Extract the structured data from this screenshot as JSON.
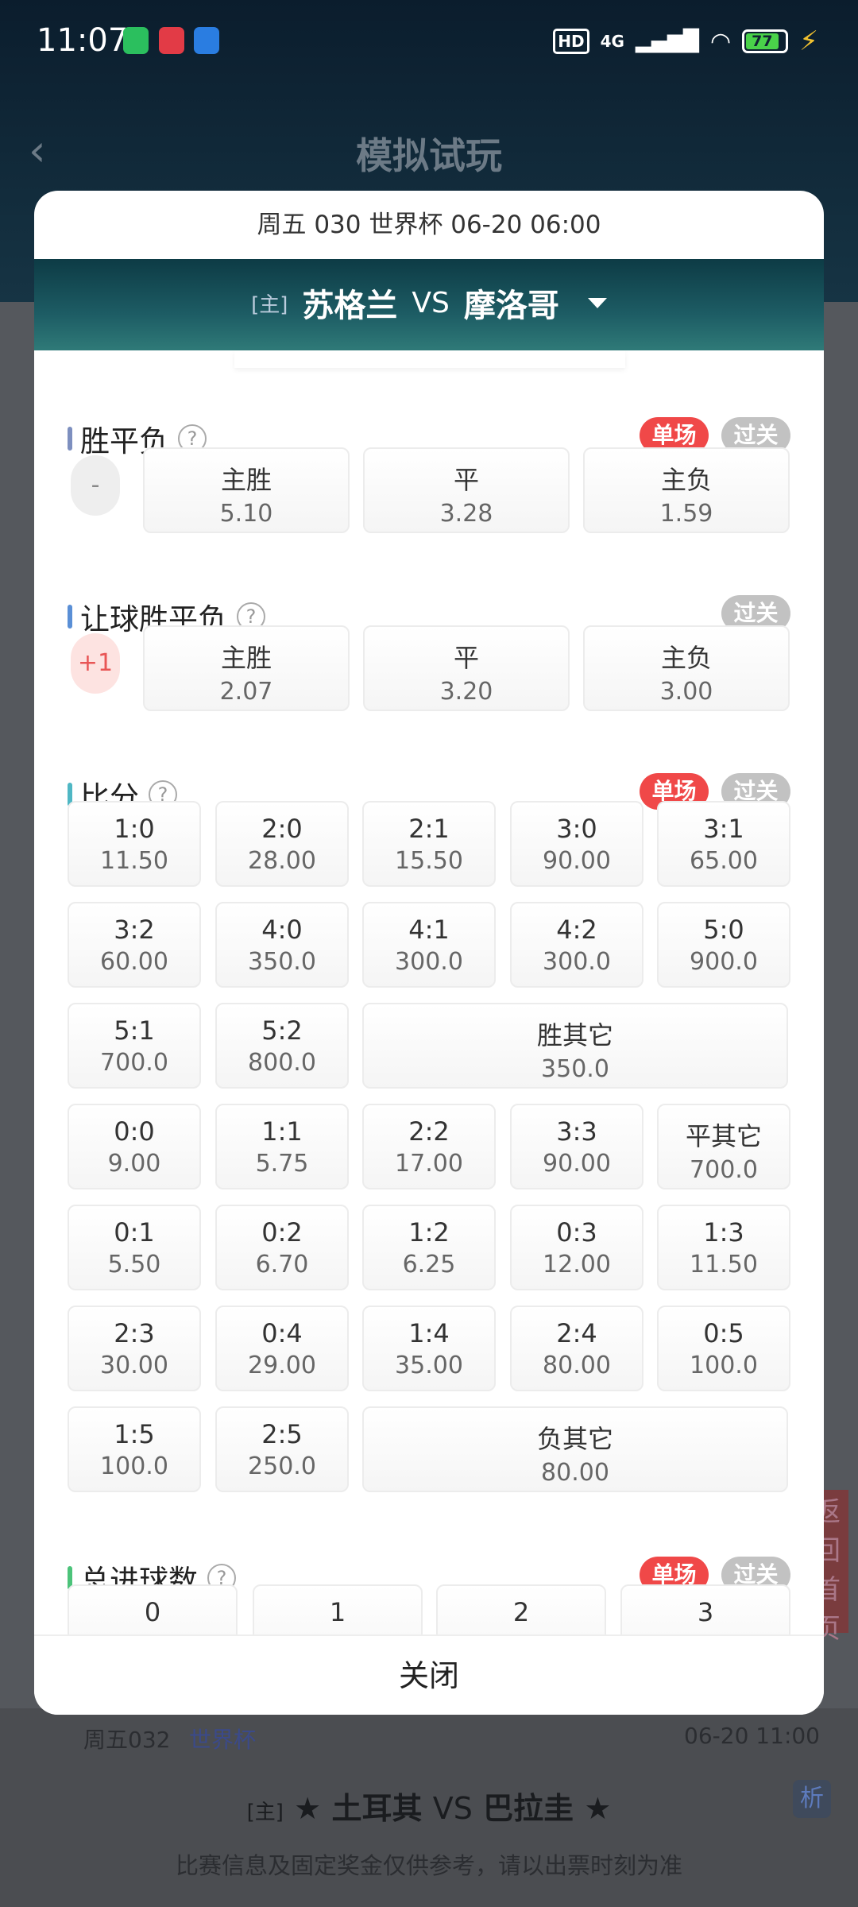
{
  "status_bar": {
    "time": "11:07",
    "hd": "HD",
    "network": "4G",
    "battery": "77"
  },
  "background": {
    "title": "模拟试玩",
    "side_text": "返回首页",
    "next_match": {
      "code": "周五032",
      "league": "世界杯",
      "time": "06-20 11:00",
      "home_tag": "[主]",
      "home": "土耳其",
      "vs": "VS",
      "away": "巴拉圭",
      "analysis": "析"
    },
    "notice": "比赛信息及固定奖金仅供参考，请以出票时刻为准"
  },
  "modal": {
    "header": "周五 030 世界杯 06-20 06:00",
    "home_tag": "[主]",
    "home_team": "苏格兰",
    "vs": "VS",
    "away_team": "摩洛哥",
    "sections": {
      "spf": {
        "title": "胜平负",
        "help": "?",
        "badge_single": "单场",
        "badge_parlay": "过关",
        "handicap": "-",
        "options": [
          {
            "label": "主胜",
            "odds": "5.10"
          },
          {
            "label": "平",
            "odds": "3.28"
          },
          {
            "label": "主负",
            "odds": "1.59"
          }
        ]
      },
      "rqspf": {
        "title": "让球胜平负",
        "help": "?",
        "badge_parlay": "过关",
        "handicap": "+1",
        "options": [
          {
            "label": "主胜",
            "odds": "2.07"
          },
          {
            "label": "平",
            "odds": "3.20"
          },
          {
            "label": "主负",
            "odds": "3.00"
          }
        ]
      },
      "score": {
        "title": "比分",
        "help": "?",
        "badge_single": "单场",
        "badge_parlay": "过关",
        "cells": [
          {
            "label": "1:0",
            "odds": "11.50"
          },
          {
            "label": "2:0",
            "odds": "28.00"
          },
          {
            "label": "2:1",
            "odds": "15.50"
          },
          {
            "label": "3:0",
            "odds": "90.00"
          },
          {
            "label": "3:1",
            "odds": "65.00"
          },
          {
            "label": "3:2",
            "odds": "60.00"
          },
          {
            "label": "4:0",
            "odds": "350.0"
          },
          {
            "label": "4:1",
            "odds": "300.0"
          },
          {
            "label": "4:2",
            "odds": "300.0"
          },
          {
            "label": "5:0",
            "odds": "900.0"
          },
          {
            "label": "5:1",
            "odds": "700.0"
          },
          {
            "label": "5:2",
            "odds": "800.0"
          },
          {
            "label": "胜其它",
            "odds": "350.0"
          },
          {
            "label": "0:0",
            "odds": "9.00"
          },
          {
            "label": "1:1",
            "odds": "5.75"
          },
          {
            "label": "2:2",
            "odds": "17.00"
          },
          {
            "label": "3:3",
            "odds": "90.00"
          },
          {
            "label": "平其它",
            "odds": "700.0"
          },
          {
            "label": "0:1",
            "odds": "5.50"
          },
          {
            "label": "0:2",
            "odds": "6.70"
          },
          {
            "label": "1:2",
            "odds": "6.25"
          },
          {
            "label": "0:3",
            "odds": "12.00"
          },
          {
            "label": "1:3",
            "odds": "11.50"
          },
          {
            "label": "2:3",
            "odds": "30.00"
          },
          {
            "label": "0:4",
            "odds": "29.00"
          },
          {
            "label": "1:4",
            "odds": "35.00"
          },
          {
            "label": "2:4",
            "odds": "80.00"
          },
          {
            "label": "0:5",
            "odds": "100.0"
          },
          {
            "label": "1:5",
            "odds": "100.0"
          },
          {
            "label": "2:5",
            "odds": "250.0"
          },
          {
            "label": "负其它",
            "odds": "80.00"
          }
        ]
      },
      "total_goals": {
        "title": "总进球数",
        "help": "?",
        "badge_single": "单场",
        "badge_parlay": "过关",
        "options": [
          "0",
          "1",
          "2",
          "3"
        ]
      }
    },
    "close_label": "关闭"
  },
  "colors": {
    "accent_red": "#f04848",
    "badge_gray": "#c2c2c2",
    "banner": "#1d5c64"
  }
}
